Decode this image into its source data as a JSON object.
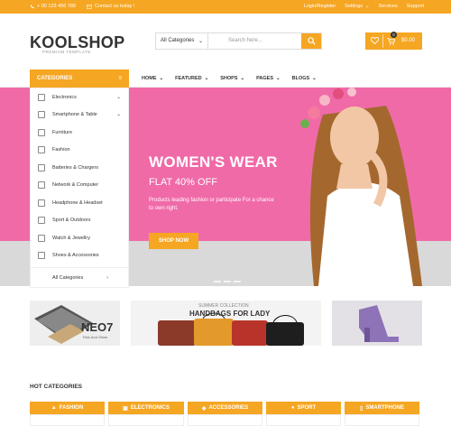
{
  "topbar": {
    "phone": "+ 00 123 456 789",
    "email": "Contact us today !",
    "login": "Login/Register",
    "settings": "Settings",
    "services": "Services",
    "support": "Support"
  },
  "header": {
    "logo": "KOOLSHOP",
    "logo_sub": "PREMIUM TEMPLATE",
    "search_category": "All Categories",
    "search_placeholder": "Search here...",
    "cart_count": "0",
    "cart_total": "$0.00"
  },
  "nav": {
    "categories_label": "CATEGORIES",
    "items": [
      "HOME",
      "FEATURED",
      "SHOPS",
      "PAGES",
      "BLOGS"
    ]
  },
  "sidebar": {
    "items": [
      "Electronics",
      "Smartphone & Table",
      "Furniture",
      "Fashion",
      "Batteries & Chargers",
      "Network & Computer",
      "Headphone & Headset",
      "Sport & Outdoors",
      "Watch & Jewellry",
      "Shoes & Accessories"
    ],
    "all_categories": "All Categories"
  },
  "hero": {
    "title": "WOMEN'S WEAR",
    "subtitle": "FLAT 40% OFF",
    "text": "Products leading fashion or participate For a chance to own right.",
    "button": "SHOP NOW"
  },
  "banners": {
    "neo_title": "NEO7",
    "neo_sub": "Rise And Shine",
    "summer_label": "SUMMER COLLECTION",
    "handbags_title": "HANDBAGS FOR LADY"
  },
  "hot": {
    "label": "HOT CATEGORIES",
    "tabs": [
      "FASHION",
      "ELECTRONICS",
      "ACCESSORIES",
      "SPORT",
      "SMARTPHONE"
    ]
  },
  "colors": {
    "accent": "#f5a623",
    "hero_pink": "#f06aa8"
  }
}
